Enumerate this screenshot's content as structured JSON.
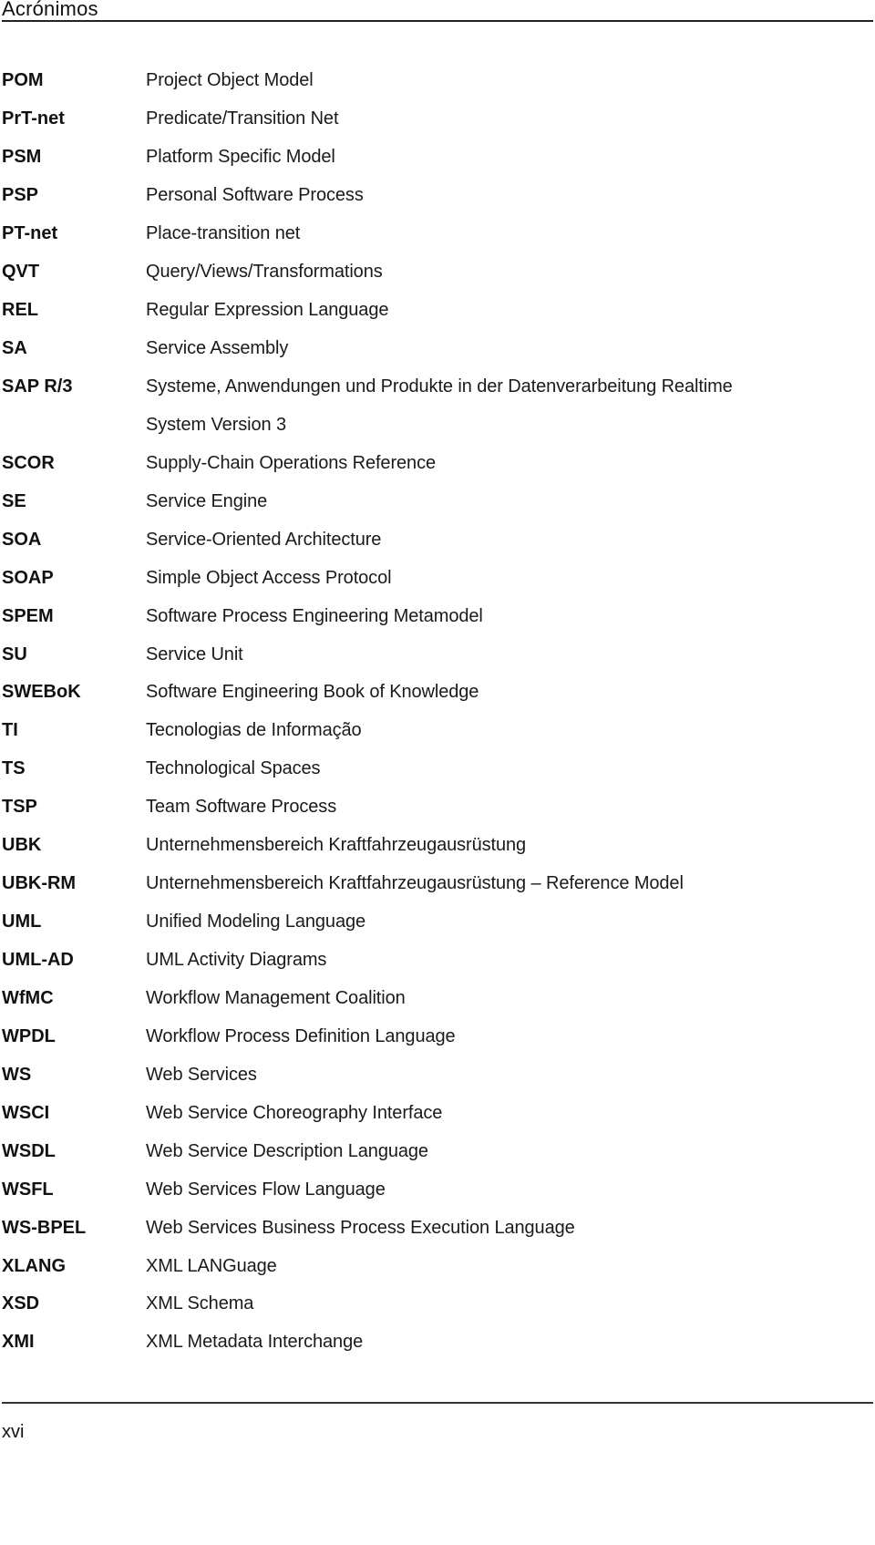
{
  "header": {
    "title": "Acrónimos"
  },
  "acronyms": [
    {
      "abbr": "POM",
      "def": "Project Object Model"
    },
    {
      "abbr": "PrT-net",
      "def": "Predicate/Transition Net"
    },
    {
      "abbr": "PSM",
      "def": "Platform Specific Model"
    },
    {
      "abbr": "PSP",
      "def": "Personal Software Process"
    },
    {
      "abbr": "PT-net",
      "def": "Place-transition net"
    },
    {
      "abbr": "QVT",
      "def": "Query/Views/Transformations"
    },
    {
      "abbr": "REL",
      "def": "Regular Expression Language"
    },
    {
      "abbr": "SA",
      "def": "Service Assembly"
    },
    {
      "abbr": "SAP R/3",
      "def": "Systeme, Anwendungen und Produkte in der Datenverarbeitung Realtime"
    },
    {
      "abbr": "",
      "def": "System Version 3"
    },
    {
      "abbr": "SCOR",
      "def": "Supply-Chain Operations Reference"
    },
    {
      "abbr": "SE",
      "def": "Service Engine"
    },
    {
      "abbr": "SOA",
      "def": "Service-Oriented Architecture"
    },
    {
      "abbr": "SOAP",
      "def": "Simple Object Access Protocol"
    },
    {
      "abbr": "SPEM",
      "def": "Software Process Engineering Metamodel"
    },
    {
      "abbr": "SU",
      "def": "Service Unit"
    },
    {
      "abbr": "SWEBoK",
      "def": "Software Engineering Book of Knowledge"
    },
    {
      "abbr": "TI",
      "def": "Tecnologias de Informação"
    },
    {
      "abbr": "TS",
      "def": "Technological Spaces"
    },
    {
      "abbr": "TSP",
      "def": "Team Software Process"
    },
    {
      "abbr": "UBK",
      "def": "Unternehmensbereich Kraftfahrzeugausrüstung"
    },
    {
      "abbr": "UBK-RM",
      "def": "Unternehmensbereich Kraftfahrzeugausrüstung – Reference Model"
    },
    {
      "abbr": "UML",
      "def": "Unified Modeling Language"
    },
    {
      "abbr": "UML-AD",
      "def": "UML Activity Diagrams"
    },
    {
      "abbr": "WfMC",
      "def": "Workflow Management Coalition"
    },
    {
      "abbr": "WPDL",
      "def": "Workflow Process Definition Language"
    },
    {
      "abbr": "WS",
      "def": "Web Services"
    },
    {
      "abbr": "WSCI",
      "def": "Web Service Choreography Interface"
    },
    {
      "abbr": "WSDL",
      "def": "Web Service Description Language"
    },
    {
      "abbr": "WSFL",
      "def": "Web Services Flow Language"
    },
    {
      "abbr": "WS-BPEL",
      "def": "Web Services Business Process Execution Language"
    },
    {
      "abbr": "XLANG",
      "def": "XML LANGuage"
    },
    {
      "abbr": "XSD",
      "def": "XML Schema"
    },
    {
      "abbr": "XMI",
      "def": "XML Metadata Interchange"
    }
  ],
  "footer": {
    "page_number": "xvi"
  }
}
